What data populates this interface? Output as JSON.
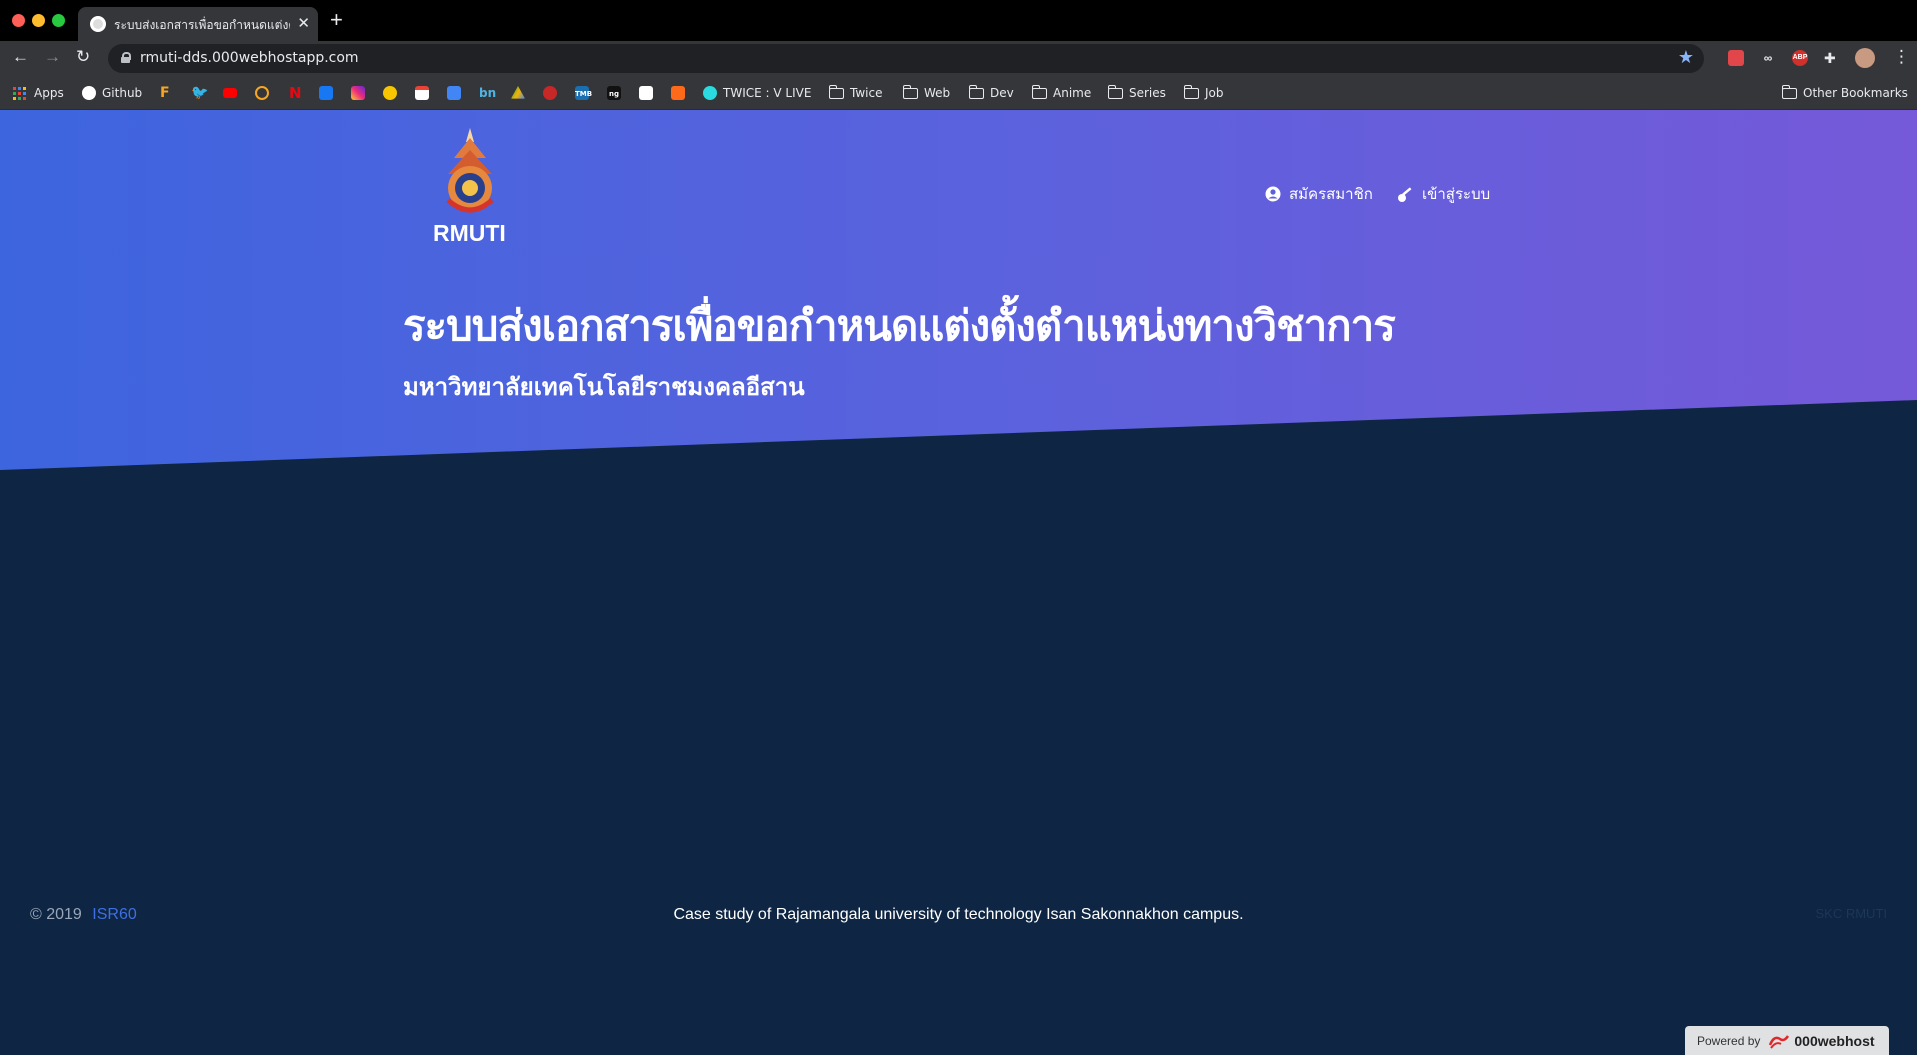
{
  "browser": {
    "tab_title": "ระบบส่งเอกสารเพื่อขอกำหนดแต่งตั้ง",
    "url": "rmuti-dds.000webhostapp.com",
    "bookmarks": {
      "apps": "Apps",
      "github": "Github",
      "twice_live": "TWICE : V LIVE",
      "folders": [
        "Twice",
        "Web",
        "Dev",
        "Anime",
        "Series",
        "Job"
      ],
      "other": "Other Bookmarks"
    },
    "extensions": {
      "abp": "ABP",
      "bn": "bn",
      "ng": "ng",
      "tm": "TMB"
    }
  },
  "header": {
    "logo_text": "RMUTI",
    "register_label": "สมัครสมาชิก",
    "login_label": "เข้าสู่ระบบ"
  },
  "hero": {
    "title": "ระบบส่งเอกสารเพื่อขอกำหนดแต่งตั้งตำแหน่งทางวิชาการ",
    "subtitle": "มหาวิทยาลัยเทคโนโลยีราชมงคลอีสาน"
  },
  "footer": {
    "copyright": "© 2019",
    "author_link": "ISR60",
    "center_text": "Case study of Rajamangala university of technology Isan Sakonnakhon campus.",
    "right_text": "SKC RMUTI",
    "powered_by": "Powered by",
    "powered_brand": "000webhost"
  },
  "colors": {
    "hero_gradient_start": "#3d65de",
    "hero_gradient_end": "#7559d9",
    "page_background": "#0e2643",
    "footer_link": "#3f6fe0"
  }
}
